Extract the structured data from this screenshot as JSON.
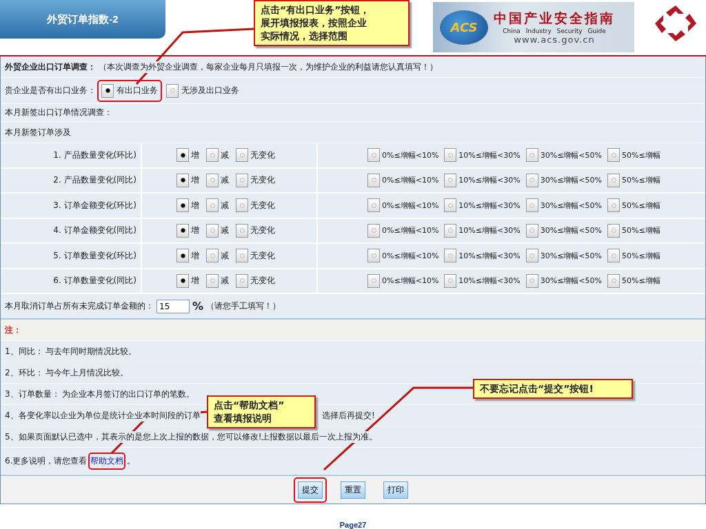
{
  "slide": {
    "title": "外贸订单指数-2",
    "page": "Page27"
  },
  "logo": {
    "badge": "ACS",
    "name_cn": "中国产业安全指南",
    "name_en": "China Industry Security Guide",
    "url": "www.acs.gov.cn"
  },
  "callouts": [
    {
      "lines": [
        "点击“有出口业务”按钮，",
        "展开填报报表，按照企业",
        "实际情况，选择范围"
      ]
    },
    {
      "lines": [
        "点击“帮助文档”",
        "查看填报说明"
      ]
    },
    {
      "lines": [
        "不要忘记点击“提交”按钮!"
      ]
    }
  ],
  "form": {
    "heading": "外贸企业出口订单调查：",
    "heading_note": "（本次调查为外贸企业调查，每家企业每月只填报一次，为维护企业的利益请您认真填写！）",
    "business_question": "贵企业是否有出口业务：",
    "business_options": [
      {
        "label": "有出口业务",
        "selected": true,
        "highlighted": true
      },
      {
        "label": "无涉及出口业务",
        "selected": false,
        "highlighted": false
      }
    ],
    "section_1": "本月新签出口订单情况调查：",
    "section_2": "本月新签订单涉及",
    "indicators": [
      {
        "label": "1. 产品数量变化(环比)",
        "direction": [
          {
            "label": "增",
            "selected": true
          },
          {
            "label": "减",
            "selected": false
          },
          {
            "label": "无变化",
            "selected": false
          }
        ],
        "range": [
          {
            "label": "0%≤增幅<10%",
            "selected": false
          },
          {
            "label": "10%≤增幅<30%",
            "selected": false
          },
          {
            "label": "30%≤增幅<50%",
            "selected": false
          },
          {
            "label": "50%≤增幅",
            "selected": false
          }
        ]
      },
      {
        "label": "2. 产品数量变化(同比)",
        "direction": [
          {
            "label": "增",
            "selected": true
          },
          {
            "label": "减",
            "selected": false
          },
          {
            "label": "无变化",
            "selected": false
          }
        ],
        "range": [
          {
            "label": "0%≤增幅<10%",
            "selected": false
          },
          {
            "label": "10%≤增幅<30%",
            "selected": false
          },
          {
            "label": "30%≤增幅<50%",
            "selected": false
          },
          {
            "label": "50%≤增幅",
            "selected": false
          }
        ]
      },
      {
        "label": "3. 订单金额变化(环比)",
        "direction": [
          {
            "label": "增",
            "selected": true
          },
          {
            "label": "减",
            "selected": false
          },
          {
            "label": "无变化",
            "selected": false
          }
        ],
        "range": [
          {
            "label": "0%≤增幅<10%",
            "selected": false
          },
          {
            "label": "10%≤增幅<30%",
            "selected": false
          },
          {
            "label": "30%≤增幅<50%",
            "selected": false
          },
          {
            "label": "50%≤增幅",
            "selected": false
          }
        ]
      },
      {
        "label": "4. 订单金额变化(同比)",
        "direction": [
          {
            "label": "增",
            "selected": true
          },
          {
            "label": "减",
            "selected": false
          },
          {
            "label": "无变化",
            "selected": false
          }
        ],
        "range": [
          {
            "label": "0%≤增幅<10%",
            "selected": false
          },
          {
            "label": "10%≤增幅<30%",
            "selected": false
          },
          {
            "label": "30%≤增幅<50%",
            "selected": false
          },
          {
            "label": "50%≤增幅",
            "selected": false
          }
        ]
      },
      {
        "label": "5. 订单数量变化(环比)",
        "direction": [
          {
            "label": "增",
            "selected": true
          },
          {
            "label": "减",
            "selected": false
          },
          {
            "label": "无变化",
            "selected": false
          }
        ],
        "range": [
          {
            "label": "0%≤增幅<10%",
            "selected": false
          },
          {
            "label": "10%≤增幅<30%",
            "selected": false
          },
          {
            "label": "30%≤增幅<50%",
            "selected": false
          },
          {
            "label": "50%≤增幅",
            "selected": false
          }
        ]
      },
      {
        "label": "6. 订单数量变化(同比)",
        "direction": [
          {
            "label": "增",
            "selected": true
          },
          {
            "label": "减",
            "selected": false
          },
          {
            "label": "无变化",
            "selected": false
          }
        ],
        "range": [
          {
            "label": "0%≤增幅<10%",
            "selected": false
          },
          {
            "label": "10%≤增幅<30%",
            "selected": false
          },
          {
            "label": "30%≤增幅<50%",
            "selected": false
          },
          {
            "label": "50%≤增幅",
            "selected": false
          }
        ]
      }
    ],
    "cancel": {
      "label": "本月取消订单占所有未完成订单金额的：",
      "value": "15",
      "unit": "%",
      "hint": "（请您手工填写！）"
    },
    "notes_title": "注：",
    "notes": [
      {
        "text": "1、同比： 与去年同时期情况比较。"
      },
      {
        "text": "2、环比： 与今年上月情况比较。"
      },
      {
        "text": "3、订单数量： 为企业本月签订的出口订单的笔数。"
      },
      {
        "text": "4、各变化率以企业为单位是统计企业本时间段的订单",
        "text_after": "选择后再提交!"
      },
      {
        "text": "5、如果页面默认已选中，其表示的是您上次上报的数据，您可以修改!上报数据以最后一次上报为准。"
      },
      {
        "text": "6.更多说明，请您查看",
        "link": "帮助文档",
        "text_after": "。",
        "highlighted": true
      }
    ],
    "buttons": [
      {
        "label": "提交",
        "highlighted": true
      },
      {
        "label": "重置",
        "highlighted": false
      },
      {
        "label": "打印",
        "highlighted": false
      }
    ]
  }
}
